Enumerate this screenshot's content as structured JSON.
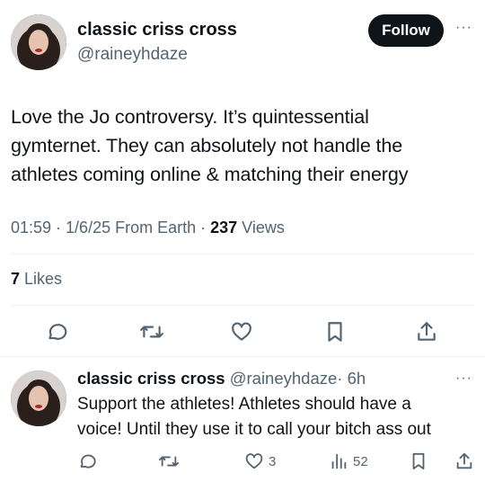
{
  "tweet": {
    "author": {
      "name": "classic criss cross",
      "handle": "@raineyhdaze"
    },
    "follow_label": "Follow",
    "more_label": "···",
    "text_lines": [
      "Love the Jo controversy. It’s quintessential",
      "gymternet. They can absolutely not handle the",
      "athletes coming online & matching their energy"
    ],
    "meta": {
      "time": "01:59",
      "sep1": " · ",
      "date": "1/6/25",
      "source": " From Earth",
      "sep2": " · ",
      "views_count": "237",
      "views_label": " Views"
    },
    "likes": {
      "count": "7",
      "label": " Likes"
    },
    "actions": [
      "reply-icon",
      "retweet-icon",
      "like-icon",
      "bookmark-icon",
      "share-icon"
    ]
  },
  "reply": {
    "author": {
      "name": "classic criss cross",
      "handle": "@raineyhdaze",
      "time": "· 6h"
    },
    "more_label": "···",
    "text_lines": [
      "Support the athletes! Athletes should have a",
      "voice! Until they use it to call your bitch ass out"
    ],
    "stats": {
      "likes": "3",
      "views": "52"
    },
    "actions": [
      "reply-icon",
      "retweet-icon",
      "like-icon",
      "views-icon",
      "bookmark-icon",
      "share-icon"
    ]
  },
  "colors": {
    "text": "#0f1419",
    "muted": "#536471",
    "divider": "#eff3f4",
    "button": "#0f1419"
  }
}
